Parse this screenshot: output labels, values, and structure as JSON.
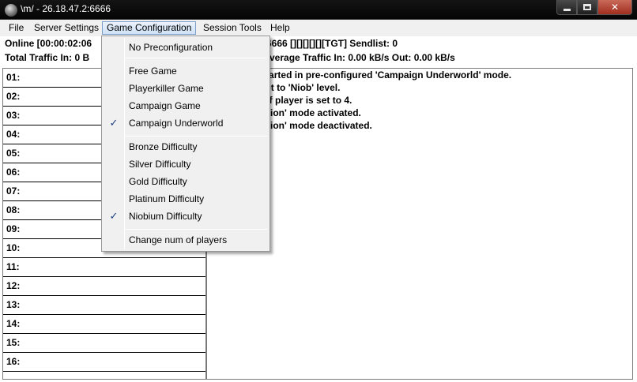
{
  "window": {
    "title": "\\m/ - 26.18.47.2:6666"
  },
  "menubar": {
    "items": [
      "File",
      "Server Settings",
      "Game Configuration",
      "Session Tools",
      "Help"
    ],
    "active": "Game Configuration"
  },
  "status": {
    "line1_left": "Online [00:00:02:06",
    "line1_right": "6666  [][][][][][TGT] Sendlist: 0",
    "line2_left": "Total Traffic In: 0 B",
    "line2_right": "verage Traffic In: 0.00 kB/s Out: 0.00 kB/s"
  },
  "players": {
    "slots": [
      "01:",
      "02:",
      "03:",
      "04:",
      "05:",
      "06:",
      "07:",
      "08:",
      "09:",
      "10:",
      "11:",
      "12:",
      "13:",
      "14:",
      "15:",
      "16:"
    ]
  },
  "log": {
    "lines": [
      "ameserver started in pre-configured 'Campaign Underworld' mode.",
      "ameserver set to 'Niob' level.",
      "ax. number of player is set to 4.",
      "No Confirmation' mode activated.",
      "No Confirmation' mode deactivated."
    ]
  },
  "dropdown": {
    "no_preconfig": "No Preconfiguration",
    "free_game": "Free Game",
    "playerkiller_game": "Playerkiller Game",
    "campaign_game": "Campaign Game",
    "campaign_underworld": "Campaign Underworld",
    "bronze": "Bronze Difficulty",
    "silver": "Silver Difficulty",
    "gold": "Gold Difficulty",
    "platinum": "Platinum Difficulty",
    "niobium": "Niobium Difficulty",
    "change_players": "Change num of players",
    "checked": [
      "Campaign Underworld",
      "Niobium Difficulty"
    ],
    "check_glyph": "✓"
  },
  "colors": {
    "titlebar": "#0a0a0a",
    "menu_highlight": "#cfe1f6",
    "check": "#1f3f80"
  }
}
